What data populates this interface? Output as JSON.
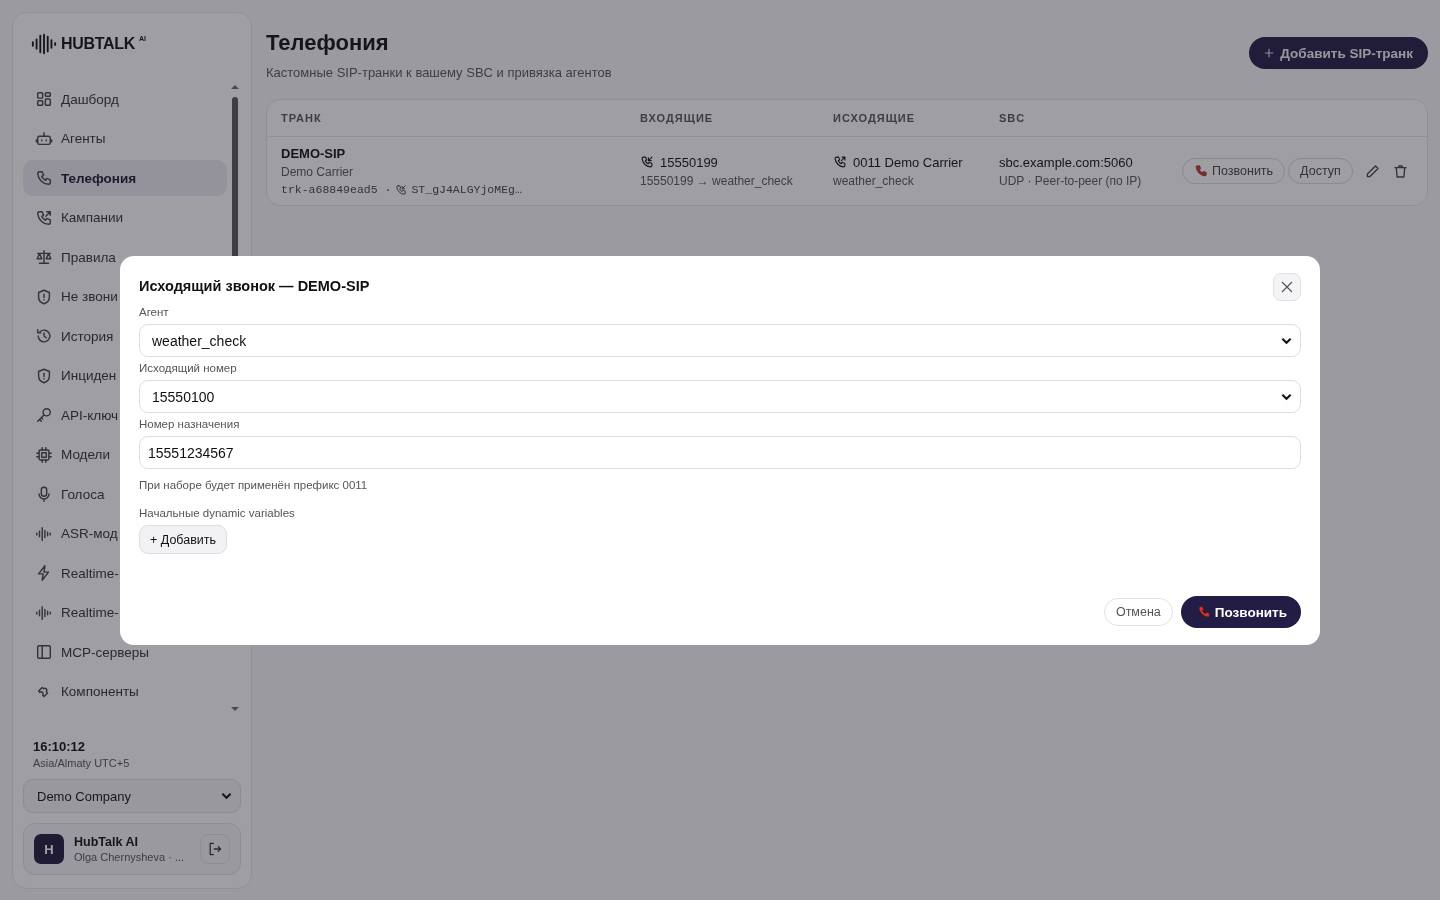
{
  "brand": {
    "name": "HUBTALK",
    "sup": "AI"
  },
  "sidebar": {
    "items": [
      {
        "label": "Дашборд",
        "kind": "grid",
        "selected": false
      },
      {
        "label": "Агенты",
        "kind": "robot",
        "selected": false
      },
      {
        "label": "Телефония",
        "kind": "phone",
        "selected": true
      },
      {
        "label": "Кампании",
        "kind": "phone-out",
        "selected": false
      },
      {
        "label": "Правила",
        "kind": "scale",
        "selected": false
      },
      {
        "label": "Не звони",
        "kind": "shield",
        "selected": false
      },
      {
        "label": "История",
        "kind": "history",
        "selected": false
      },
      {
        "label": "Инциден",
        "kind": "shield",
        "selected": false
      },
      {
        "label": "API-ключ",
        "kind": "key",
        "selected": false
      },
      {
        "label": "Модели",
        "kind": "chip",
        "selected": false
      },
      {
        "label": "Голоса",
        "kind": "mic",
        "selected": false
      },
      {
        "label": "ASR-мод",
        "kind": "wave",
        "selected": false
      },
      {
        "label": "Realtime-",
        "kind": "bolt",
        "selected": false
      },
      {
        "label": "Realtime-",
        "kind": "wave",
        "selected": false
      },
      {
        "label": "MCP-серверы",
        "kind": "panel",
        "selected": false
      },
      {
        "label": "Компоненты",
        "kind": "puzzle",
        "selected": false
      }
    ],
    "clock": {
      "time": "16:10:12",
      "zone": "Asia/Almaty UTC+5"
    },
    "company_select": {
      "value": "Demo Company"
    },
    "user": {
      "initial": "H",
      "name": "HubTalk AI",
      "subtitle": "Olga Chernysheva · ..."
    }
  },
  "page": {
    "title": "Телефония",
    "subtitle": "Кастомные SIP-транки к вашему SBC и привязка агентов",
    "add_button": "Добавить SIP-транк"
  },
  "table": {
    "columns": [
      "ТРАНК",
      "ВХОДЯЩИЕ",
      "ИСХОДЯЩИЕ",
      "SBC"
    ],
    "rows": [
      {
        "name": "DEMO-SIP",
        "carrier": "Demo Carrier",
        "id": "trk-a68849ead5 ·",
        "inbound_ref": "ST_gJ4ALGYjoMEg…",
        "inbound": {
          "number": "15550199",
          "route": "15550199 → weather_check"
        },
        "outbound": {
          "number": "0011 Demo Carrier",
          "agent": "weather_check"
        },
        "sbc": {
          "host": "sbc.example.com:5060",
          "mode": "UDP · Peer-to-peer (по IP)"
        },
        "call_button": "Позвонить",
        "access_button": "Доступ"
      }
    ]
  },
  "modal": {
    "title": "Исходящий звонок — DEMO-SIP",
    "fields": [
      {
        "kind": "select",
        "label": "Агент",
        "value": "weather_check"
      },
      {
        "kind": "select",
        "label": "Исходящий номер",
        "value": "15550100"
      },
      {
        "kind": "input",
        "label": "Номер назначения",
        "value": "15551234567"
      }
    ],
    "hint": "При наборе будет применён префикс 0011",
    "variables_label": "Начальные dynamic variables",
    "add_button": "+ Добавить",
    "cancel_button": "Отмена",
    "call_button": "Позвонить"
  }
}
